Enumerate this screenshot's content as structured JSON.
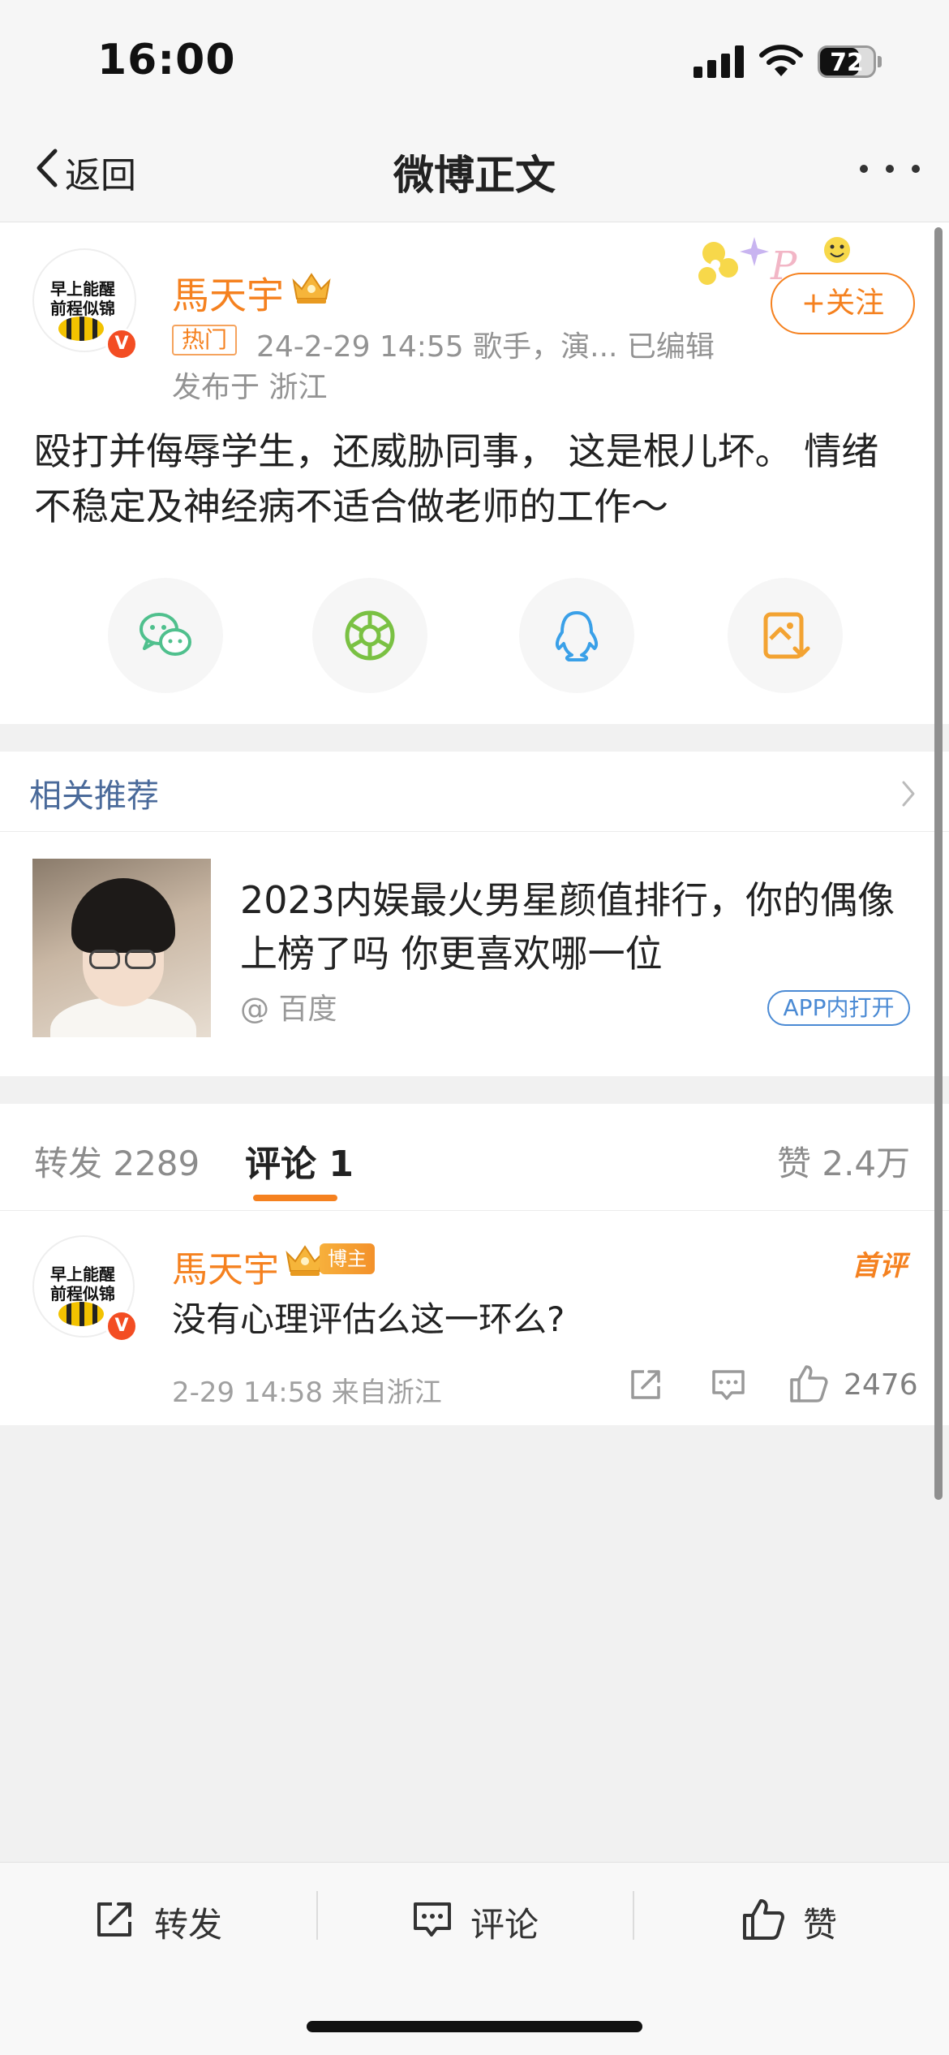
{
  "status_bar": {
    "time": "16:00",
    "battery": "72",
    "battery_level": 0.72
  },
  "nav": {
    "back_label": "返回",
    "title": "微博正文"
  },
  "post": {
    "avatar_text_line1": "早上能醒",
    "avatar_text_line2": "前程似锦",
    "verified_badge": "V",
    "username": "馬天宇",
    "hot_tag": "热门",
    "meta": "24-2-29 14:55  歌手，演...  已编辑",
    "location": "发布于 浙江",
    "follow_label": "+关注",
    "text": "殴打并侮辱学生，还威胁同事， 这是根儿坏。 情绪不稳定及神经病不适合做老师的工作～",
    "share_targets": [
      "wechat-icon",
      "moments-icon",
      "qq-icon",
      "save-image-icon"
    ]
  },
  "recommendation": {
    "header": "相关推荐",
    "title": "2023内娱最火男星颜值排行，你的偶像上榜了吗 你更喜欢哪一位",
    "source": "@ 百度",
    "app_button": "APP内打开"
  },
  "stats": {
    "repost_label": "转发 2289",
    "comments_label": "评论 1",
    "likes_label": "赞 2.4万"
  },
  "comment": {
    "avatar_text_line1": "早上能醒",
    "avatar_text_line2": "前程似锦",
    "verified_badge": "V",
    "username": "馬天宇",
    "blogger_badge": "博主",
    "first_badge": "首评",
    "text": "没有心理评估么这一环么?",
    "time": "2-29 14:58 来自浙江",
    "like_count": "2476"
  },
  "toolbar": {
    "repost_label": "转发",
    "comment_label": "评论",
    "like_label": "赞"
  },
  "colors": {
    "accent_orange": "#f5811f",
    "link_blue": "#4a6a9a",
    "background": "#f1f1f1"
  }
}
